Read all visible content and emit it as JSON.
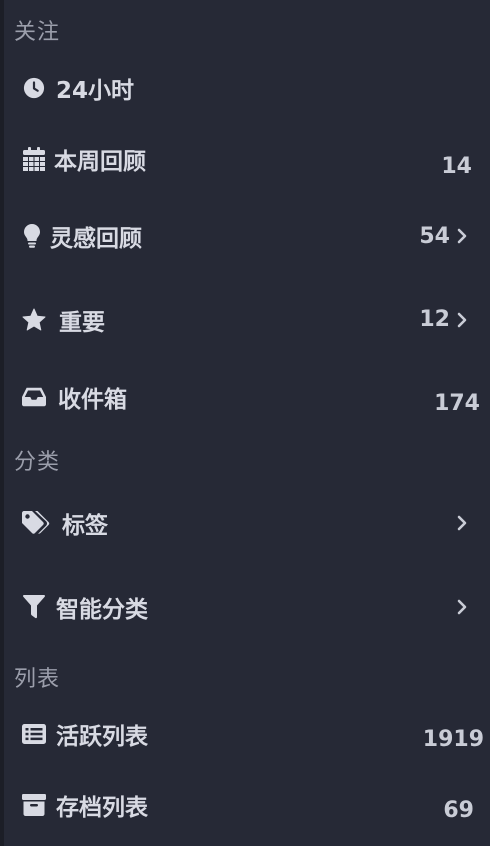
{
  "sections": {
    "follow": "关注",
    "category": "分类",
    "lists": "列表"
  },
  "items": {
    "hours24": {
      "label": "24小时",
      "icon": "clock-icon"
    },
    "week_review": {
      "label": "本周回顾",
      "count": "14",
      "icon": "calendar-icon"
    },
    "inspiration_review": {
      "label": "灵感回顾",
      "count": "54",
      "icon": "lightbulb-icon"
    },
    "important": {
      "label": "重要",
      "count": "12",
      "icon": "star-icon"
    },
    "inbox": {
      "label": "收件箱",
      "count": "174",
      "icon": "inbox-icon"
    },
    "tags": {
      "label": "标签",
      "icon": "tags-icon"
    },
    "smart_category": {
      "label": "智能分类",
      "icon": "filter-icon"
    },
    "active_lists": {
      "label": "活跃列表",
      "count": "1919",
      "icon": "list-icon"
    },
    "archived_lists": {
      "label": "存档列表",
      "count": "69",
      "icon": "archive-icon"
    }
  },
  "colors": {
    "background": "#262936",
    "text": "#d8dae3",
    "section_text": "#9b9eab"
  }
}
